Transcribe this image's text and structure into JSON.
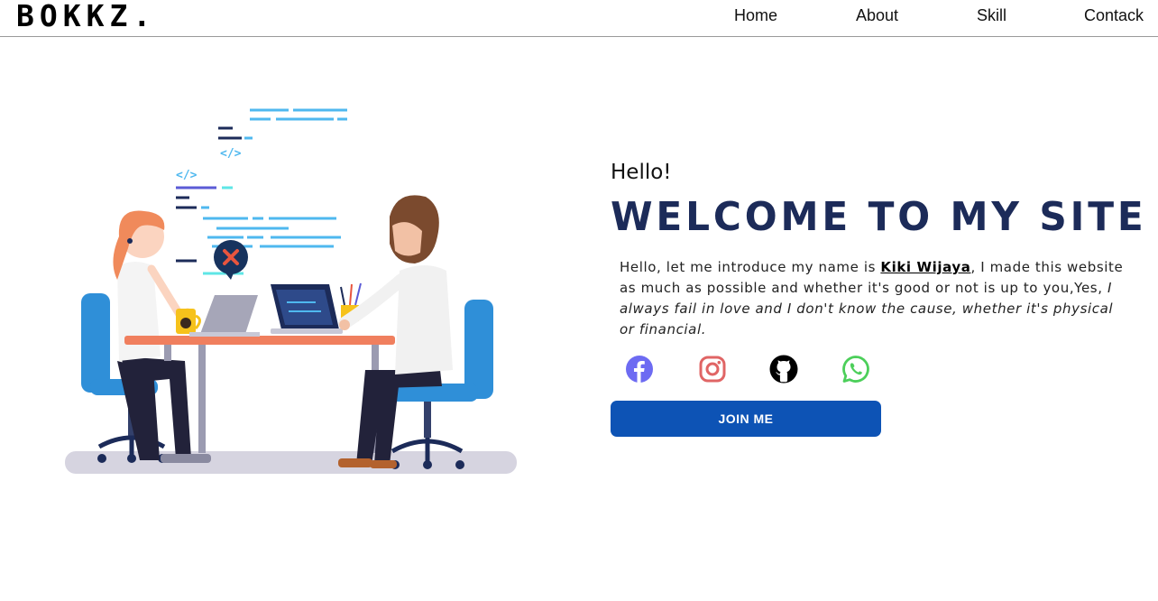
{
  "nav": {
    "logo": "BOKKZ.",
    "links": [
      "Home",
      "About",
      "Skill",
      "Contack"
    ]
  },
  "hero": {
    "greeting": "Hello!",
    "headline": "WELCOME TO MY SITE",
    "intro_before_name": "Hello, let me introduce my name is ",
    "name": "Kiki Wijaya",
    "intro_after_name": ", I made this website as much as possible and whether it's good or not is up to you,Yes, ",
    "intro_italic": "I always fail in love and I don't know the cause, whether it's physical or financial.",
    "join_button": "JOIN ME"
  },
  "socials": [
    {
      "icon": "facebook-icon",
      "color": "#6d6bf2"
    },
    {
      "icon": "instagram-icon",
      "color": "#e06565"
    },
    {
      "icon": "github-icon",
      "color": "#000000"
    },
    {
      "icon": "whatsapp-icon",
      "color": "#4ccf5a"
    }
  ],
  "colors": {
    "headline": "#1c2b59",
    "button": "#0d53b5"
  }
}
